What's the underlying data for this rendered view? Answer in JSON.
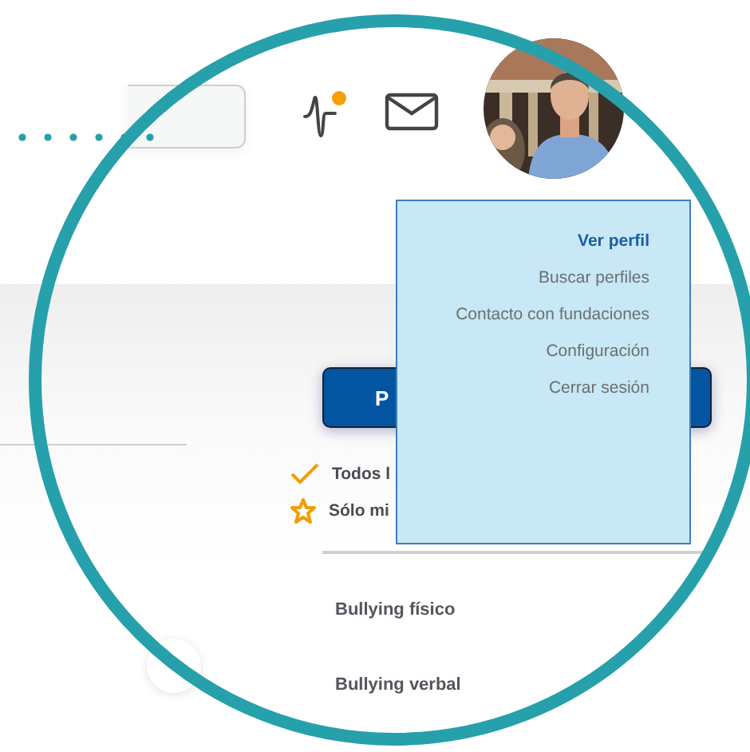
{
  "primary_button": {
    "label": "P"
  },
  "filters": [
    {
      "kind": "check",
      "label": "Todos l"
    },
    {
      "kind": "star",
      "label": "Sólo mi"
    }
  ],
  "categories": [
    "Bullying físico",
    "Bullying verbal"
  ],
  "profile_menu": {
    "items": [
      {
        "label": "Ver perfil",
        "selected": true
      },
      {
        "label": "Buscar perfiles",
        "selected": false
      },
      {
        "label": "Contacto con fundaciones",
        "selected": false
      },
      {
        "label": "Configuración",
        "selected": false
      },
      {
        "label": "Cerrar sesión",
        "selected": false
      }
    ]
  }
}
